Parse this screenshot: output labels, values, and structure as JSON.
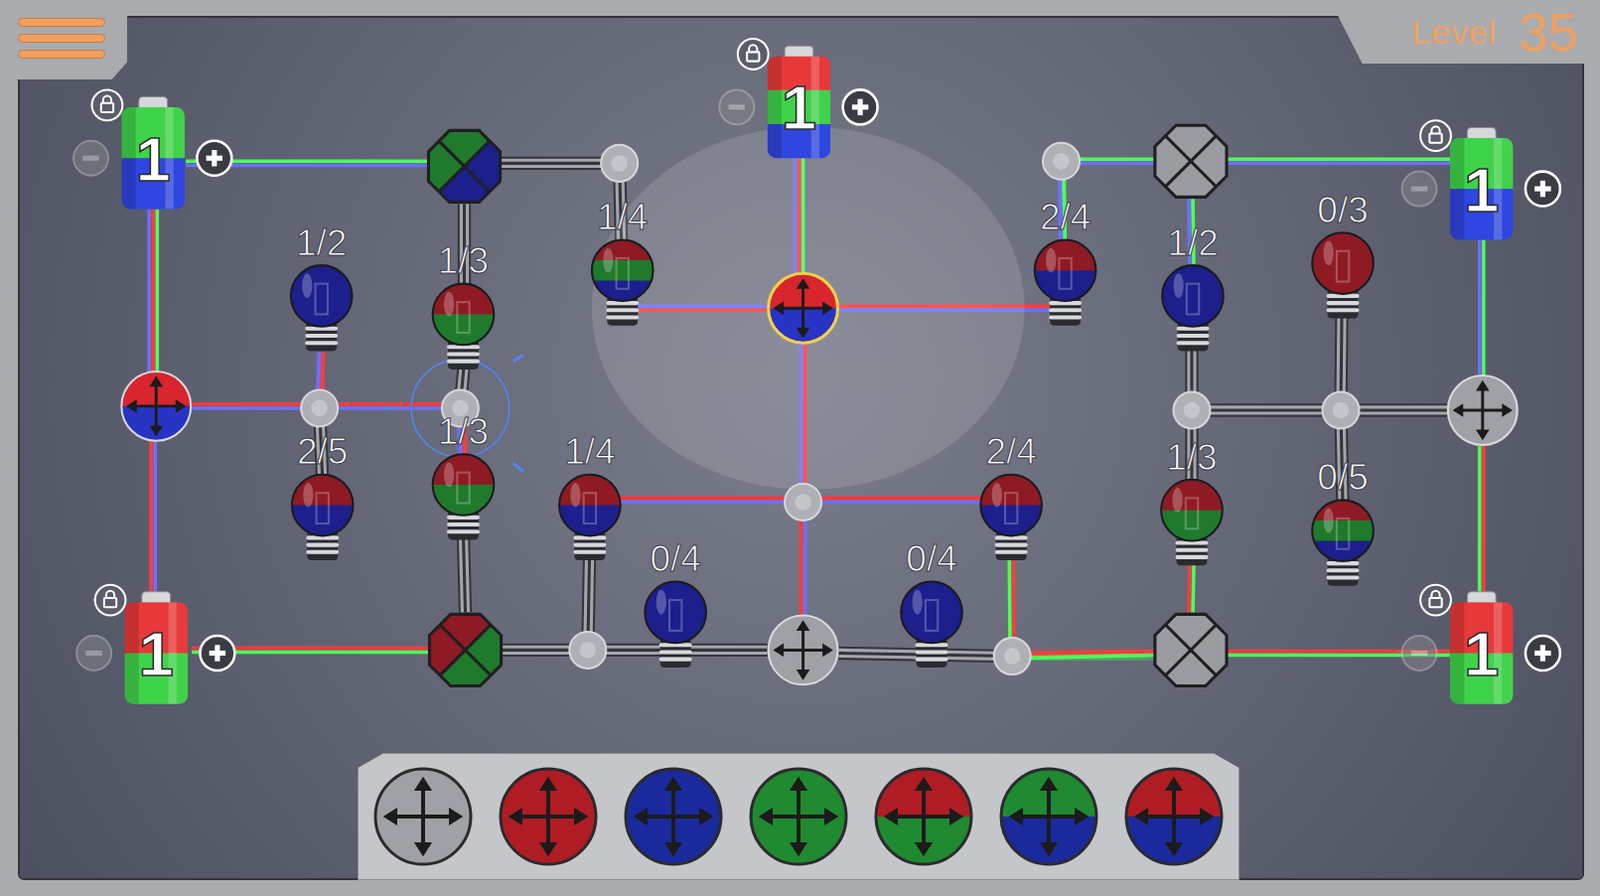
{
  "level": {
    "label": "Level",
    "value": "35"
  },
  "batteries": [
    {
      "charge": "1",
      "colors": [
        "#3fd34a",
        "#2f46e0"
      ],
      "locked": true,
      "can_decrease": false,
      "can_increase": true
    },
    {
      "charge": "1",
      "colors": [
        "#e8393a",
        "#3fd34a",
        "#2f46e0"
      ],
      "locked": true,
      "can_decrease": false,
      "can_increase": true
    },
    {
      "charge": "1",
      "colors": [
        "#3fd34a",
        "#2f46e0"
      ],
      "locked": true,
      "can_decrease": false,
      "can_increase": true
    },
    {
      "charge": "1",
      "colors": [
        "#e8393a",
        "#3fd34a"
      ],
      "locked": true,
      "can_decrease": false,
      "can_increase": true
    },
    {
      "charge": "1",
      "colors": [
        "#e8393a",
        "#3fd34a"
      ],
      "locked": true,
      "can_decrease": false,
      "can_increase": true
    }
  ],
  "nodes": [
    {
      "kind": "splitter",
      "colors": [
        "#1f7a2c",
        "#1c1f8c",
        "#1c1f8c",
        "#1f7a2c"
      ],
      "selected": false,
      "hovered": false
    },
    {
      "kind": "splitter",
      "colors": [],
      "selected": false,
      "hovered": false
    },
    {
      "kind": "splitter",
      "colors": [
        "#8e1a24",
        "#1f7a2c",
        "#1f7a2c",
        "#8e1a24"
      ],
      "selected": false,
      "hovered": false
    },
    {
      "kind": "splitter",
      "colors": [],
      "selected": false,
      "hovered": false
    },
    {
      "kind": "mover",
      "colors": [
        "#d8252e",
        "#2734c4"
      ],
      "selected": false,
      "hovered": false
    },
    {
      "kind": "mover",
      "colors": [
        "#d8252e",
        "#2734c4"
      ],
      "selected": true,
      "hovered": false
    },
    {
      "kind": "mover",
      "colors": [],
      "selected": false,
      "hovered": false
    },
    {
      "kind": "mover",
      "colors": [],
      "selected": false,
      "hovered": false
    },
    {
      "kind": "junction",
      "colors": [],
      "selected": false,
      "hovered": false
    },
    {
      "kind": "junction",
      "colors": [],
      "selected": false,
      "hovered": false
    },
    {
      "kind": "junction",
      "colors": [],
      "selected": false,
      "hovered": false
    },
    {
      "kind": "junction",
      "colors": [],
      "selected": false,
      "hovered": true
    },
    {
      "kind": "junction",
      "colors": [],
      "selected": false,
      "hovered": false
    },
    {
      "kind": "junction",
      "colors": [],
      "selected": false,
      "hovered": false
    },
    {
      "kind": "junction",
      "colors": [],
      "selected": false,
      "hovered": false
    },
    {
      "kind": "junction",
      "colors": [],
      "selected": false,
      "hovered": false
    },
    {
      "kind": "junction",
      "colors": [],
      "selected": false,
      "hovered": false
    }
  ],
  "bulbs": [
    {
      "label": "1/2",
      "colors": [
        "#1c1f8c"
      ]
    },
    {
      "label": "1/3",
      "colors": [
        "#8e1a24",
        "#1f7a2c"
      ]
    },
    {
      "label": "1/4",
      "colors": [
        "#8e1a24",
        "#1f7a2c",
        "#1c1f8c"
      ]
    },
    {
      "label": "2/4",
      "colors": [
        "#8e1a24",
        "#1c1f8c"
      ]
    },
    {
      "label": "1/2",
      "colors": [
        "#1c1f8c"
      ]
    },
    {
      "label": "0/3",
      "colors": [
        "#8e1a24"
      ]
    },
    {
      "label": "2/5",
      "colors": [
        "#8e1a24",
        "#1c1f8c"
      ]
    },
    {
      "label": "1/3",
      "colors": [
        "#8e1a24",
        "#1f7a2c"
      ]
    },
    {
      "label": "1/4",
      "colors": [
        "#8e1a24",
        "#1c1f8c"
      ]
    },
    {
      "label": "0/4",
      "colors": [
        "#1c1f8c"
      ]
    },
    {
      "label": "2/4",
      "colors": [
        "#8e1a24",
        "#1c1f8c"
      ]
    },
    {
      "label": "0/4",
      "colors": [
        "#1c1f8c"
      ]
    },
    {
      "label": "1/3",
      "colors": [
        "#8e1a24",
        "#1f7a2c"
      ]
    },
    {
      "label": "0/5",
      "colors": [
        "#8e1a24",
        "#1f7a2c",
        "#1c1f8c"
      ]
    }
  ],
  "wires": [
    {
      "colors": [
        "#4cff5a",
        "#6f6fff"
      ]
    },
    {
      "colors": [
        "#4cff5a",
        "#ff3b3b",
        "#6f6fff"
      ]
    },
    {
      "colors": [
        "#6f6fff",
        "#ff3b3b"
      ]
    },
    {
      "colors": [
        "#ff3b3b",
        "#6f6fff"
      ]
    },
    {
      "colors": [
        "#ff3b3b",
        "#6f6fff"
      ]
    },
    {
      "colors": [
        "#ff3b3b",
        "#6f6fff"
      ]
    },
    {
      "colors": []
    },
    {
      "colors": []
    },
    {
      "colors": []
    },
    {
      "colors": []
    },
    {
      "colors": []
    },
    {
      "colors": [
        "#ff3b3b",
        "#6f6fff"
      ]
    },
    {
      "colors": []
    },
    {
      "colors": [
        "#ff3b3b",
        "#4cff5a"
      ]
    },
    {
      "colors": []
    },
    {
      "colors": []
    },
    {
      "colors": []
    },
    {
      "colors": [
        "#ff3b3b",
        "#6f6fff"
      ]
    },
    {
      "colors": [
        "#ff3b3b",
        "#6f6fff"
      ]
    },
    {
      "colors": [
        "#ff3b3b",
        "#6f6fff"
      ]
    },
    {
      "colors": [
        "#6f6fff",
        "#ff3b3b"
      ]
    },
    {
      "colors": [
        "#4cff5a",
        "#ff3b3b",
        "#6f6fff"
      ]
    },
    {
      "colors": [
        "#ff3b3b",
        "#6f6fff"
      ]
    },
    {
      "colors": [
        "#ff3b3b",
        "#6f6fff"
      ]
    },
    {
      "colors": []
    },
    {
      "colors": [
        "#4cff5a",
        "#ff3b3b"
      ]
    },
    {
      "colors": [
        "#ff3b3b",
        "#4cff5a"
      ]
    },
    {
      "colors": [
        "#ff3b3b",
        "#4cff5a"
      ]
    },
    {
      "colors": [
        "#4cff5a",
        "#6f6fff"
      ]
    },
    {
      "colors": [
        "#4cff5a",
        "#6f6fff"
      ]
    },
    {
      "colors": [
        "#4cff5a",
        "#6f6fff"
      ]
    },
    {
      "colors": [
        "#4cff5a",
        "#6f6fff"
      ]
    },
    {
      "colors": []
    },
    {
      "colors": []
    },
    {
      "colors": []
    },
    {
      "colors": []
    },
    {
      "colors": []
    },
    {
      "colors": []
    },
    {
      "colors": [
        "#4cff5a",
        "#ff3b3b"
      ]
    },
    {
      "colors": [
        "#4cff5a",
        "#6f6fff"
      ]
    },
    {
      "colors": [
        "#ff3b3b",
        "#4cff5a"
      ]
    }
  ],
  "palette": [
    {
      "colors": []
    },
    {
      "colors": [
        "#b01c24"
      ]
    },
    {
      "colors": [
        "#1a2a9c"
      ]
    },
    {
      "colors": [
        "#1f8a30"
      ]
    },
    {
      "colors": [
        "#b01c24",
        "#1f8a30"
      ]
    },
    {
      "colors": [
        "#1f8a30",
        "#1a2a9c"
      ]
    },
    {
      "colors": [
        "#b01c24",
        "#1a2a9c"
      ]
    }
  ]
}
